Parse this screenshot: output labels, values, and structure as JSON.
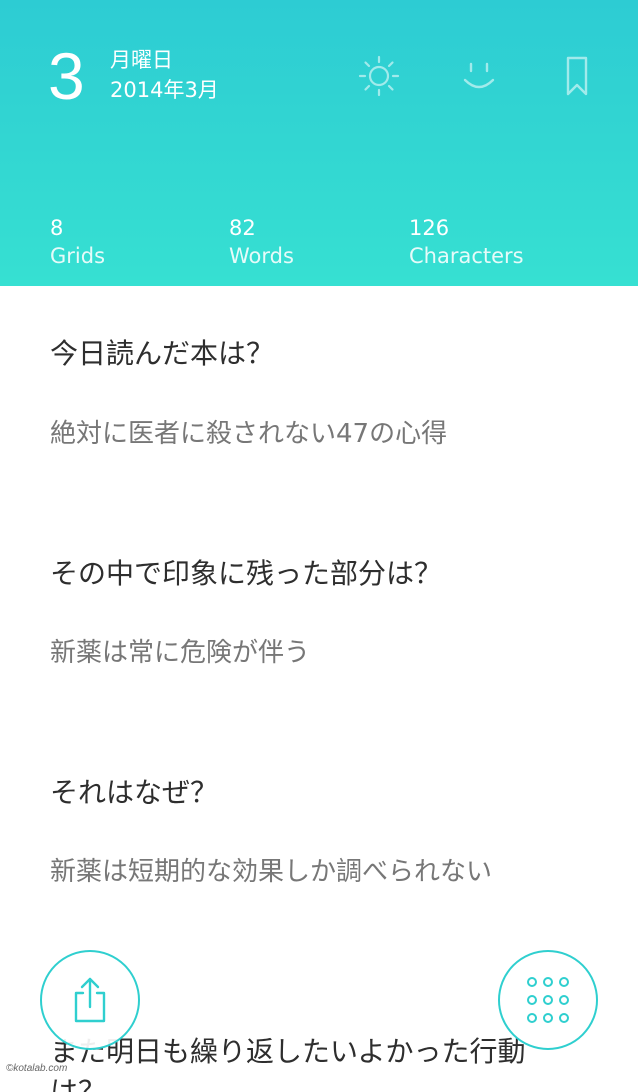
{
  "header": {
    "day": "3",
    "weekday": "月曜日",
    "month": "2014年3月",
    "icons": [
      "sun-icon",
      "smile-icon",
      "bookmark-icon"
    ],
    "stats": [
      {
        "value": "8",
        "label": "Grids"
      },
      {
        "value": "82",
        "label": "Words"
      },
      {
        "value": "126",
        "label": "Characters"
      }
    ],
    "gradient_top": "#2dccd3",
    "gradient_bottom": "#36e0d2"
  },
  "entries": [
    {
      "question": "今日読んだ本は？",
      "answer": "絶対に医者に殺されない47の心得"
    },
    {
      "question": "その中で印象に残った部分は？",
      "answer": "新薬は常に危険が伴う"
    },
    {
      "question": "それはなぜ？",
      "answer": "新薬は短期的な効果しか調べられない"
    },
    {
      "question": "また明日も繰り返したいよかった行動は？",
      "answer": ""
    }
  ],
  "buttons": {
    "share_icon": "share-icon",
    "grid_icon": "grid-menu-icon",
    "accent": "#2fcfcf"
  },
  "watermark": "©kotalab.com"
}
